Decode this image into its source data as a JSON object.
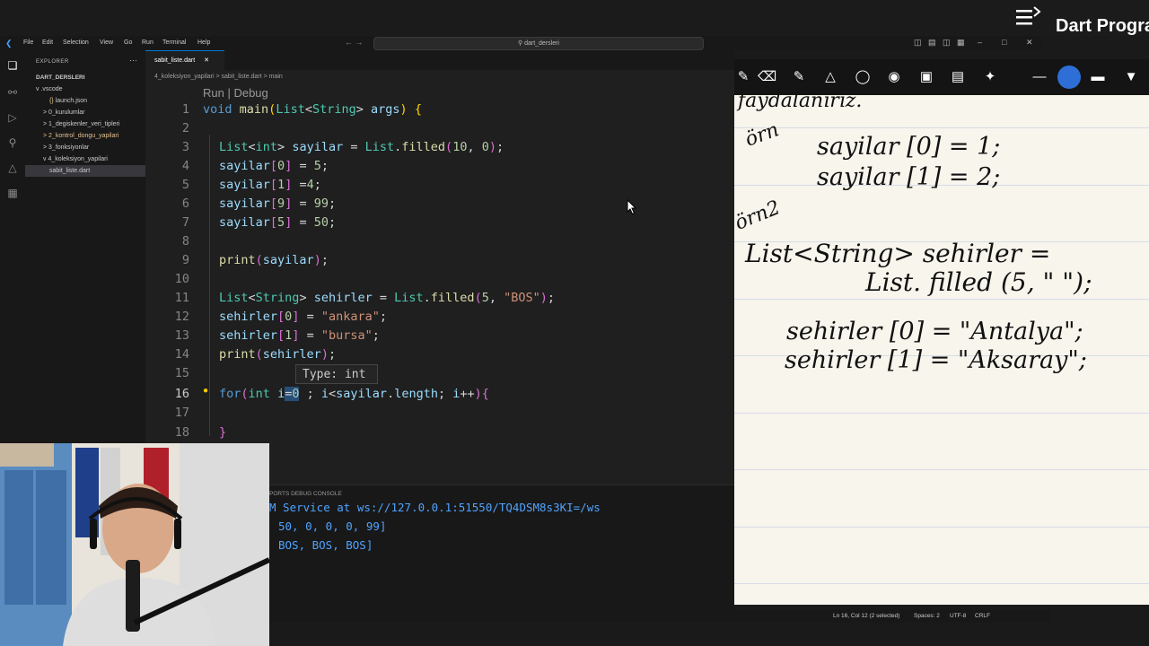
{
  "video": {
    "title": "Dart Progra"
  },
  "titlebar": {
    "menu": [
      "File",
      "Edit",
      "Selection",
      "View",
      "Go",
      "Run",
      "Terminal",
      "Help"
    ],
    "search": "dart_dersleri"
  },
  "explorer": {
    "title": "EXPLORER",
    "root": "DART_DERSLERI",
    "items": [
      {
        "label": "v .vscode"
      },
      {
        "label": "launch.json"
      },
      {
        "label": "> 0_kurulumlar"
      },
      {
        "label": "> 1_degiskenler_veri_tipleri"
      },
      {
        "label": "> 2_kontrol_dongu_yapilari"
      },
      {
        "label": "> 3_fonksiyonlar"
      },
      {
        "label": "v 4_koleksiyon_yapilari"
      },
      {
        "label": "sabit_liste.dart"
      }
    ]
  },
  "editor": {
    "tab": "sabit_liste.dart",
    "breadcrumb": "4_koleksiyon_yapilari  >  sabit_liste.dart  >  main",
    "codelens": "Run | Debug",
    "tooltip": "Type: int",
    "lines": [
      {
        "n": "1"
      },
      {
        "n": "2"
      },
      {
        "n": "3"
      },
      {
        "n": "4"
      },
      {
        "n": "5"
      },
      {
        "n": "6"
      },
      {
        "n": "7"
      },
      {
        "n": "8"
      },
      {
        "n": "9"
      },
      {
        "n": "10"
      },
      {
        "n": "11"
      },
      {
        "n": "12"
      },
      {
        "n": "13"
      },
      {
        "n": "14"
      },
      {
        "n": "15"
      },
      {
        "n": "16"
      },
      {
        "n": "17"
      },
      {
        "n": "18"
      }
    ]
  },
  "panel": {
    "tabs": "PORTS     DEBUG CONSOLE",
    "output": [
      "M Service at ws://127.0.0.1:51550/TQ4DSM8s3KI=/ws",
      "50, 0, 0, 0, 99]",
      "BOS, BOS, BOS]"
    ]
  },
  "statusbar": {
    "position": "Ln 16, Col 12 (2 selected)",
    "spaces": "Spaces: 2",
    "encoding": "UTF-8",
    "eol": "CRLF"
  },
  "whiteboard": {
    "notes": [
      "faydalanırız.",
      "örn",
      "sayilar [0] = 1;",
      "sayilar [1] = 2;",
      "örn2",
      "List<String> sehirler =",
      "List. filled (5, \" \");",
      "sehirler [0] = \"Antalya\";",
      "sehirler [1] = \"Aksaray\";"
    ]
  },
  "colors": {
    "editor_bg": "#1f1f1f",
    "accent": "#0078d4",
    "paper": "#f7f5ec",
    "console_text": "#4fa3ff"
  }
}
